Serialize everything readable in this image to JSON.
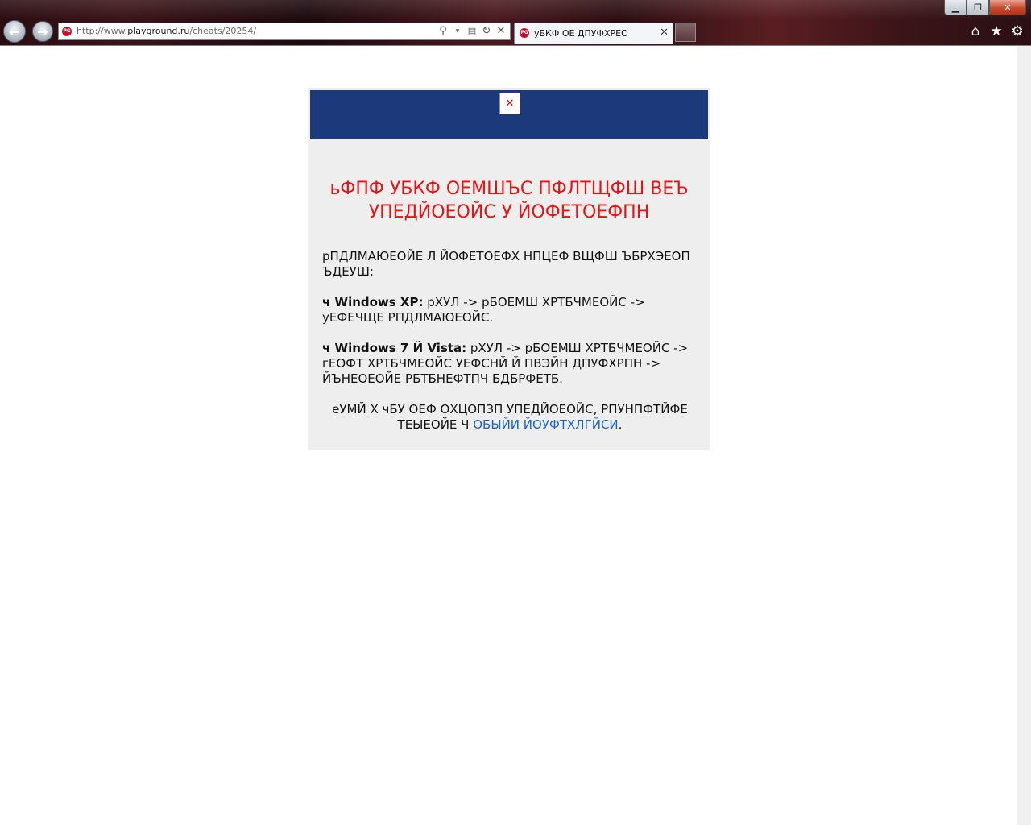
{
  "browser": {
    "address_url_prefix": "http://www.",
    "address_url_domain": "playground.ru",
    "address_url_path": "/cheats/20254/",
    "tab_title": "уБКФ ОЕ ДПУФХРЕО",
    "favicon_text": "PG"
  },
  "window_controls": {
    "minimize": "▁",
    "restore": "❐",
    "close": "✕"
  },
  "page": {
    "headline": "ьФПФ УБКФ ОЕМШЪС ПФЛТЩФШ ВЕЪ УПЕДЙОЕОЙС У ЙОФЕТОЕФПН",
    "intro": "рПДЛМАЮЕОЙЕ Л ЙОФЕТОЕФХ НПЦЕФ ВЩФШ ЪБРХЭЕОП ЪДЕУШ:",
    "xp_label": "ч Windows XP:",
    "xp_text": "рХУЛ -> рБОЕМШ ХРТБЧМЕОЙС -> уЕФЕЧЩЕ РПДЛМАЮЕОЙС.",
    "vista_label": "ч Windows 7 Й Vista:",
    "vista_text": "рХУЛ -> рБОЕМШ ХРТБЧМЕОЙС -> гЕОФТ ХРТБЧМЕОЙС УЕФСНЙ Й ПВЭЙН ДПУФХРПН -> ЙЪНЕОЕОЙЕ РБТБНЕФТПЧ БДБРФЕТБ.",
    "footer_text": "еУМЙ Х чБУ ОЕФ ОХЦОПЗП УПЕДЙОЕОЙС, РПУНПФТЙФЕ ТЕЫЕОЙЕ Ч",
    "footer_link": "ОБЫЙИ ЙОУФТХЛГЙСИ",
    "footer_end": "."
  },
  "colors": {
    "panel_header": "#1c3a7b",
    "headline": "#e81313",
    "link": "#1a64c8",
    "panel_bg": "#eeeeee"
  }
}
